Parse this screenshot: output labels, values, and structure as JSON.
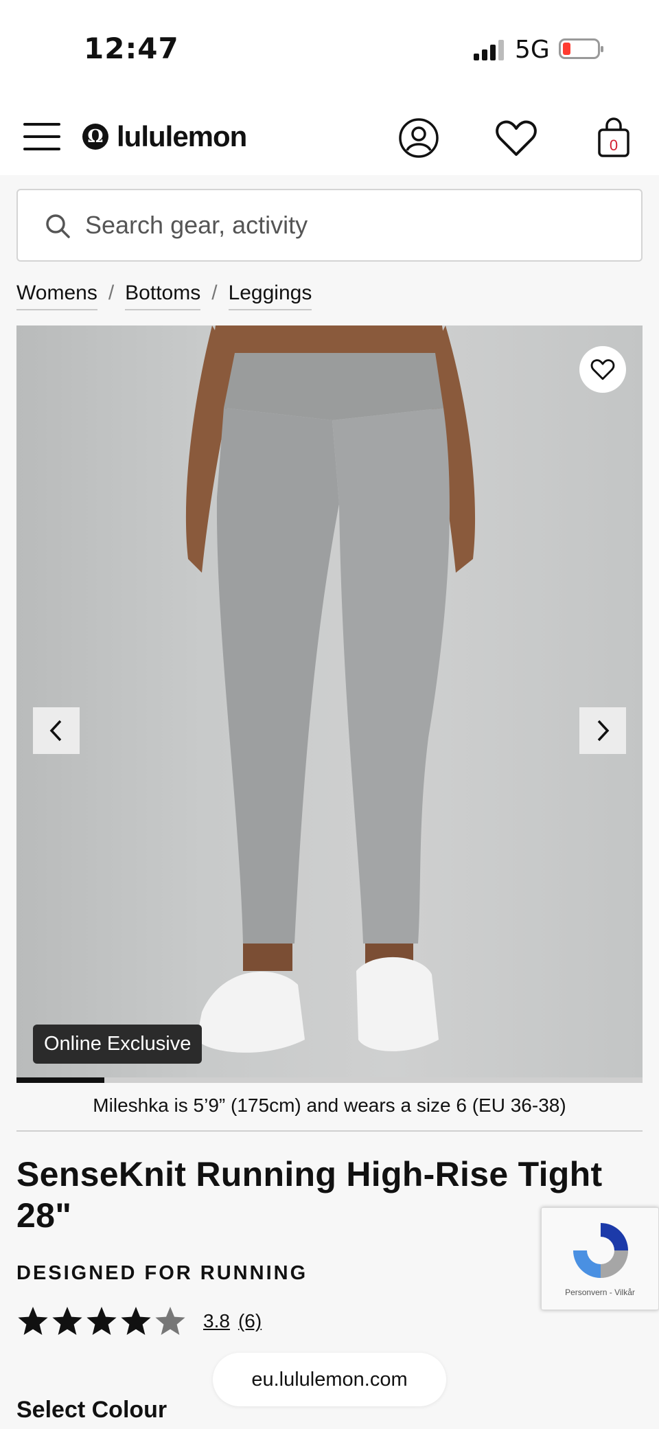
{
  "status_bar": {
    "time": "12:47",
    "network": "5G"
  },
  "header": {
    "brand": "lululemon",
    "bag_count": "0"
  },
  "search": {
    "placeholder": "Search gear, activity"
  },
  "breadcrumbs": [
    {
      "label": "Womens"
    },
    {
      "label": "Bottoms"
    },
    {
      "label": "Leggings"
    }
  ],
  "gallery": {
    "badge": "Online Exclusive",
    "progress_fraction": 0.14
  },
  "product": {
    "model_caption": "Mileshka is 5’9” (175cm) and wears a size 6 (EU 36-38)",
    "title": "SenseKnit Running High-Rise Tight 28\"",
    "designed_for": "DESIGNED FOR RUNNING",
    "rating": 3.8,
    "rating_label": "3.8",
    "review_count": "(6)",
    "select_colour_label": "Select Colour"
  },
  "browser": {
    "url": "eu.lululemon.com"
  },
  "recaptcha": {
    "label": "Personvern - Vilkår"
  },
  "colors": {
    "accent": "#111111",
    "battery_low": "#ff3b30",
    "bag_badge": "#d22030"
  }
}
